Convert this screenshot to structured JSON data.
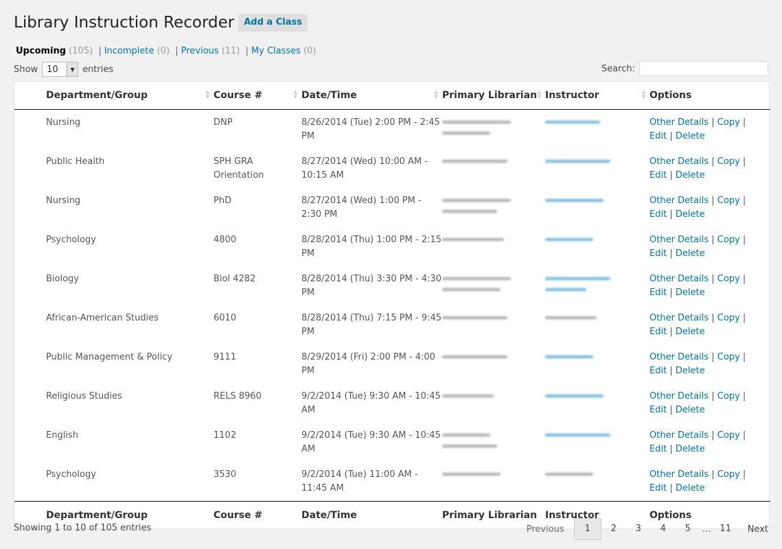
{
  "page": {
    "title": "Library Instruction Recorder",
    "add_button": "Add a Class"
  },
  "filters": {
    "upcoming": {
      "label": "Upcoming",
      "count": "(105)"
    },
    "incomplete": {
      "label": "Incomplete",
      "count": "(0)"
    },
    "previous": {
      "label": "Previous",
      "count": "(11)"
    },
    "my_classes": {
      "label": "My Classes",
      "count": "(0)"
    },
    "separator": "|"
  },
  "length": {
    "prefix": "Show",
    "value": "10",
    "suffix": "entries"
  },
  "search": {
    "label": "Search:"
  },
  "columns": [
    "Department/Group",
    "Course #",
    "Date/Time",
    "Primary Librarian",
    "Instructor",
    "Options"
  ],
  "options_links": {
    "details": "Other Details",
    "copy": "Copy",
    "edit": "Edit",
    "delete": "Delete",
    "separator": "|"
  },
  "rows": [
    {
      "department": "Nursing",
      "course": "DNP",
      "datetime": "8/26/2014 (Tue) 2:00 PM - 2:45 PM"
    },
    {
      "department": "Public Health",
      "course": "SPH GRA Orientation",
      "datetime": "8/27/2014 (Wed) 10:00 AM - 10:15 AM"
    },
    {
      "department": "Nursing",
      "course": "PhD",
      "datetime": "8/27/2014 (Wed) 1:00 PM - 2:30 PM"
    },
    {
      "department": "Psychology",
      "course": "4800",
      "datetime": "8/28/2014 (Thu) 1:00 PM - 2:15 PM"
    },
    {
      "department": "Biology",
      "course": "Biol 4282",
      "datetime": "8/28/2014 (Thu) 3:30 PM - 4:30 PM"
    },
    {
      "department": "African-American Studies",
      "course": "6010",
      "datetime": "8/28/2014 (Thu) 7:15 PM - 9:45 PM"
    },
    {
      "department": "Public Management & Policy",
      "course": "9111",
      "datetime": "8/29/2014 (Fri) 2:00 PM - 4:00 PM"
    },
    {
      "department": "Religious Studies",
      "course": "RELS 8960",
      "datetime": "9/2/2014 (Tue) 9:30 AM - 10:45 AM"
    },
    {
      "department": "English",
      "course": "1102",
      "datetime": "9/2/2014 (Tue) 9:30 AM - 10:45 AM"
    },
    {
      "department": "Psychology",
      "course": "3530",
      "datetime": "9/2/2014 (Tue) 11:00 AM - 11:45 AM"
    }
  ],
  "info": "Showing 1 to 10 of 105 entries",
  "pagination": {
    "previous": "Previous",
    "pages": [
      "1",
      "2",
      "3",
      "4",
      "5"
    ],
    "ellipsis": "…",
    "last": "11",
    "next": "Next"
  },
  "colors": {
    "link": "#0074a2",
    "background": "#f1f1f1"
  }
}
